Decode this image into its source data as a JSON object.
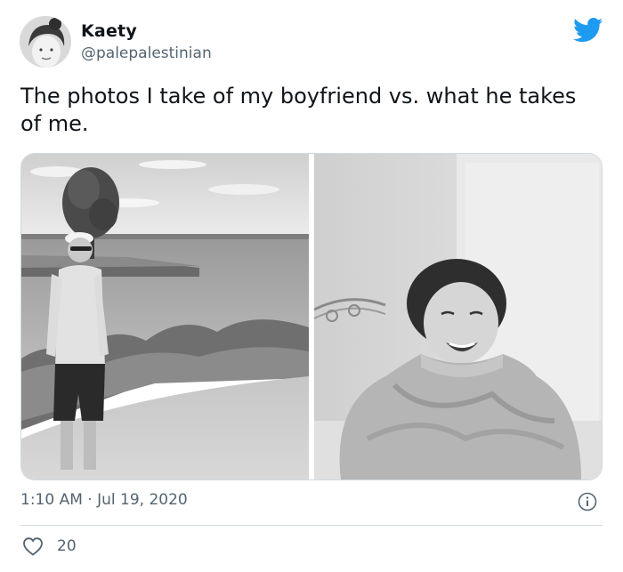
{
  "user": {
    "name": "Kaety",
    "handle": "@palepalestinian"
  },
  "tweet": {
    "text": "The photos I take of my boyfriend vs. what he takes of me.",
    "timestamp": "1:10 AM · Jul 19, 2020",
    "like_count": "20"
  },
  "icons": {
    "brand": "twitter-bird-icon",
    "info": "info-icon",
    "like": "heart-icon"
  },
  "colors": {
    "brand_blue": "#1d9bf0",
    "text_primary": "#0f1419",
    "text_secondary": "#536471",
    "border": "#cfd9de"
  }
}
